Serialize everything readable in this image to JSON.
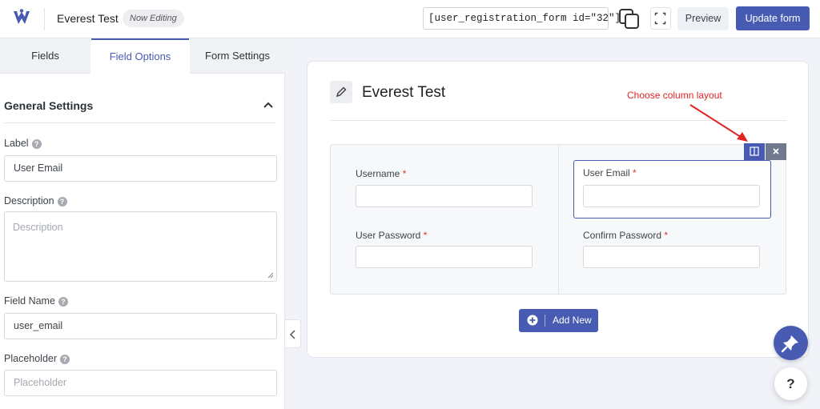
{
  "header": {
    "form_title": "Everest Test",
    "status_badge": "Now Editing",
    "shortcode": "[user_registration_form id=\"32\"]",
    "preview_label": "Preview",
    "update_label": "Update form",
    "brand_color": "#475bb2"
  },
  "tabs": [
    {
      "label": "Fields",
      "active": false
    },
    {
      "label": "Field Options",
      "active": true
    },
    {
      "label": "Form Settings",
      "active": false
    }
  ],
  "settings": {
    "section_title": "General Settings",
    "label": {
      "title": "Label",
      "value": "User Email"
    },
    "description": {
      "title": "Description",
      "placeholder": "Description"
    },
    "field_name": {
      "title": "Field Name",
      "value": "user_email"
    },
    "placeholder": {
      "title": "Placeholder",
      "placeholder": "Placeholder"
    },
    "help_glyph": "?"
  },
  "builder": {
    "title": "Everest Test",
    "annotation": "Choose column layout",
    "annotation_color": "#e02424",
    "required_mark": "*",
    "fields": [
      {
        "label": "Username"
      },
      {
        "label": "User Email"
      },
      {
        "label": "User Password"
      },
      {
        "label": "Confirm Password"
      }
    ],
    "add_new_label": "Add New"
  },
  "help_button": "?",
  "icons": {
    "logo": "user-registration-logo",
    "copy": "copy-icon",
    "expand": "fullscreen-icon",
    "collapse": "chevron-left-icon",
    "edit": "pencil-icon",
    "columns": "column-layout-icon",
    "close": "close-icon",
    "add": "plus-circle-icon",
    "pin": "pin-icon",
    "help": "help-icon"
  }
}
